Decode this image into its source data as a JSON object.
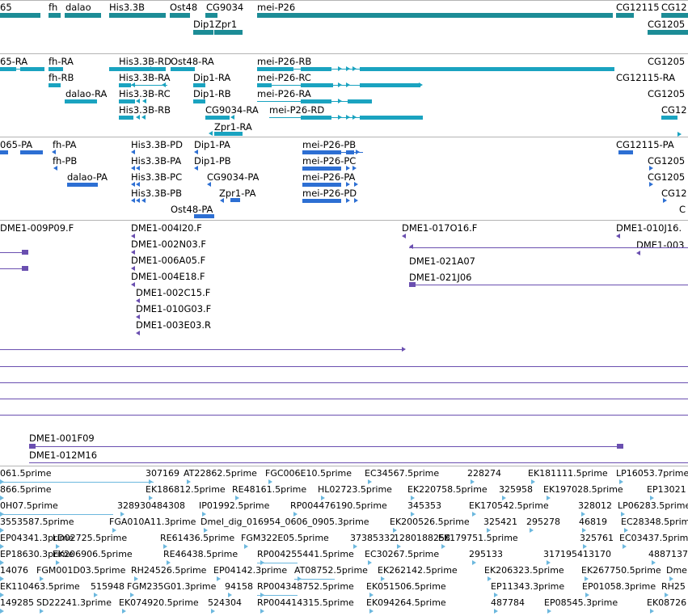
{
  "colors": {
    "gene": "#1c8c96",
    "transcript": "#1aa3c0",
    "cds": "#2d6fd3",
    "clone": "#6a4fb0",
    "est": "#6cb8de",
    "divider": "#b4b4b4"
  },
  "tracks": {
    "genes": [
      {
        "label": "65"
      },
      {
        "label": "fh"
      },
      {
        "label": "dalao"
      },
      {
        "label": "His3.3B"
      },
      {
        "label": "Ost48"
      },
      {
        "label": "CG9034"
      },
      {
        "label": "mei-P26"
      },
      {
        "label": "CG12115"
      },
      {
        "label": "CG12"
      },
      {
        "label": "Dip1"
      },
      {
        "label": "Zpr1"
      },
      {
        "label": "CG1205"
      }
    ],
    "transcripts": [
      {
        "label": "65-RA"
      },
      {
        "label": "fh-RA"
      },
      {
        "label": "fh-RB"
      },
      {
        "label": "dalao-RA"
      },
      {
        "label": "His3.3B-RD"
      },
      {
        "label": "His3.3B-RA"
      },
      {
        "label": "His3.3B-RC"
      },
      {
        "label": "His3.3B-RB"
      },
      {
        "label": "Ost48-RA"
      },
      {
        "label": "Dip1-RA"
      },
      {
        "label": "Dip1-RB"
      },
      {
        "label": "CG9034-RA"
      },
      {
        "label": "Zpr1-RA"
      },
      {
        "label": "mei-P26-RB"
      },
      {
        "label": "mei-P26-RC"
      },
      {
        "label": "mei-P26-RA"
      },
      {
        "label": "mei-P26-RD"
      },
      {
        "label": "CG1205"
      },
      {
        "label": "CG12115-RA"
      },
      {
        "label": "CG1205"
      },
      {
        "label": "CG12"
      }
    ],
    "proteins": [
      {
        "label": "065-PA"
      },
      {
        "label": "fh-PA"
      },
      {
        "label": "fh-PB"
      },
      {
        "label": "dalao-PA"
      },
      {
        "label": "His3.3B-PD"
      },
      {
        "label": "His3.3B-PA"
      },
      {
        "label": "His3.3B-PC"
      },
      {
        "label": "His3.3B-PB"
      },
      {
        "label": "Ost48-PA"
      },
      {
        "label": "Dip1-PA"
      },
      {
        "label": "Dip1-PB"
      },
      {
        "label": "CG9034-PA"
      },
      {
        "label": "Zpr1-PA"
      },
      {
        "label": "mei-P26-PB"
      },
      {
        "label": "mei-P26-PC"
      },
      {
        "label": "mei-P26-PA"
      },
      {
        "label": "mei-P26-PD"
      },
      {
        "label": "CG12115-PA"
      },
      {
        "label": "CG1205"
      },
      {
        "label": "CG1205"
      },
      {
        "label": "CG12"
      },
      {
        "label": "C"
      }
    ],
    "clones": [
      {
        "label": "DME1-009P09.F"
      },
      {
        "label": "DME1-004I20.F"
      },
      {
        "label": "DME1-002N03.F"
      },
      {
        "label": "DME1-006A05.F"
      },
      {
        "label": "DME1-004E18.F"
      },
      {
        "label": "DME1-002C15.F"
      },
      {
        "label": "DME1-010G03.F"
      },
      {
        "label": "DME1-003E03.R"
      },
      {
        "label": "DME1-017O16.F"
      },
      {
        "label": "DME1-021A07"
      },
      {
        "label": "DME1-021J06"
      },
      {
        "label": "DME1-010J16."
      },
      {
        "label": "DME1-003"
      },
      {
        "label": "DME1-001F09"
      },
      {
        "label": "DME1-012M16"
      }
    ],
    "ests": [
      {
        "label": "061.5prime"
      },
      {
        "label": "307169"
      },
      {
        "label": "AT22862.5prime"
      },
      {
        "label": "FGC006E10.5prime"
      },
      {
        "label": "EC34567.5prime"
      },
      {
        "label": "228274"
      },
      {
        "label": "EK181111.5prime"
      },
      {
        "label": "LP16053.7prime"
      },
      {
        "label": "866.5prime"
      },
      {
        "label": "EK186812.5prime"
      },
      {
        "label": "RE48161.5prime"
      },
      {
        "label": "HL02723.5prime"
      },
      {
        "label": "EK220758.5prime"
      },
      {
        "label": "325958"
      },
      {
        "label": "EK197028.5prime"
      },
      {
        "label": "EP13021"
      },
      {
        "label": "0H07.5prime"
      },
      {
        "label": "328930484308"
      },
      {
        "label": "IP01992.5prime"
      },
      {
        "label": "RP004476190.5prime"
      },
      {
        "label": "345353"
      },
      {
        "label": "EK170542.5prime"
      },
      {
        "label": "328012"
      },
      {
        "label": "LP06283.5prime"
      },
      {
        "label": "3553587.5prime"
      },
      {
        "label": "FGA010A11.3prime"
      },
      {
        "label": "Dmel_dig_016954_0606_0905.3prime"
      },
      {
        "label": "EK200526.5prime"
      },
      {
        "label": "325421"
      },
      {
        "label": "295278"
      },
      {
        "label": "46819"
      },
      {
        "label": "EC28348.5prime"
      },
      {
        "label": "EP04341.3prime"
      },
      {
        "label": "LD02725.5prime"
      },
      {
        "label": "RE61436.5prime"
      },
      {
        "label": "FGM322E05.5prime"
      },
      {
        "label": "37385332"
      },
      {
        "label": "1280188258"
      },
      {
        "label": "EK179751.5prime"
      },
      {
        "label": "325761"
      },
      {
        "label": "EC03437.5prime"
      },
      {
        "label": "EP18630.3prime"
      },
      {
        "label": "EK206906.5prime"
      },
      {
        "label": "RE46438.5prime"
      },
      {
        "label": "RP004255441.5prime"
      },
      {
        "label": "EC30267.5prime"
      },
      {
        "label": "295133"
      },
      {
        "label": "317195413170"
      },
      {
        "label": "4887137"
      },
      {
        "label": "14076"
      },
      {
        "label": "FGM001D03.5prime"
      },
      {
        "label": "RH24526.5prime"
      },
      {
        "label": "EP04142.3prime"
      },
      {
        "label": "AT08752.5prime"
      },
      {
        "label": "EK262142.5prime"
      },
      {
        "label": "EK206323.5prime"
      },
      {
        "label": "EK267750.5prime"
      },
      {
        "label": "Dme"
      },
      {
        "label": "EK110463.5prime"
      },
      {
        "label": "515948"
      },
      {
        "label": "FGM235G01.3prime"
      },
      {
        "label": "94158"
      },
      {
        "label": "RP004348752.5prime"
      },
      {
        "label": "EK051506.5prime"
      },
      {
        "label": "EP11343.3prime"
      },
      {
        "label": "EP01058.3prime"
      },
      {
        "label": "RH25"
      },
      {
        "label": "149285"
      },
      {
        "label": "SD22241.3prime"
      },
      {
        "label": "EK074920.5prime"
      },
      {
        "label": "524304"
      },
      {
        "label": "RP004414315.5prime"
      },
      {
        "label": "EK094264.5prime"
      },
      {
        "label": "487784"
      },
      {
        "label": "EP08545.3prime"
      },
      {
        "label": "EK08726"
      }
    ]
  }
}
